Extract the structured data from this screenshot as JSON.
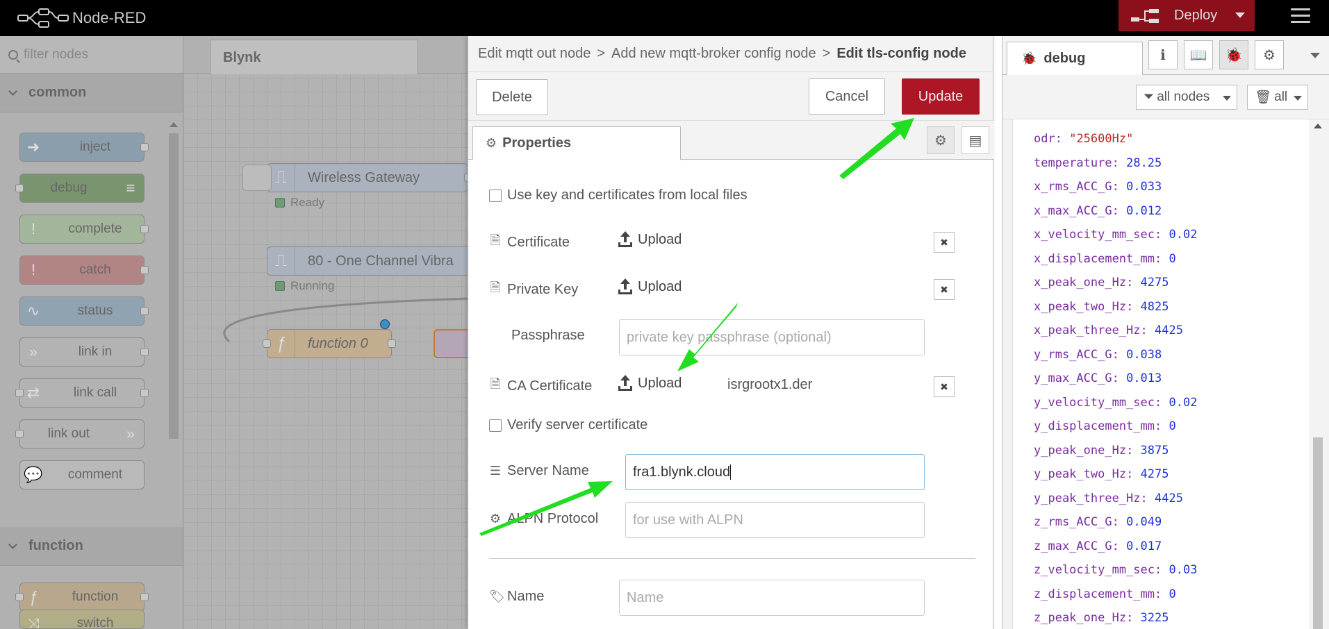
{
  "app": {
    "title": "Node-RED"
  },
  "header": {
    "deploy_label": "Deploy"
  },
  "palette": {
    "filter_placeholder": "filter nodes",
    "categories": [
      "common",
      "function"
    ],
    "nodes": [
      {
        "label": "inject",
        "color": "#8a9fab"
      },
      {
        "label": "debug",
        "color": "#7b9470"
      },
      {
        "label": "complete",
        "color": "#a3b59a"
      },
      {
        "label": "catch",
        "color": "#b28585"
      },
      {
        "label": "status",
        "color": "#8fa3b0"
      },
      {
        "label": "link in",
        "color": "#b3b3b3"
      },
      {
        "label": "link call",
        "color": "#b3b3b3"
      },
      {
        "label": "link out",
        "color": "#b3b3b3"
      },
      {
        "label": "comment",
        "color": "#b9b9b9"
      },
      {
        "label": "function",
        "color": "#b8a78c"
      },
      {
        "label": "switch",
        "color": "#b1ad86"
      }
    ]
  },
  "workspace": {
    "tab": "Blynk",
    "nodes": [
      {
        "label": "Wireless Gateway",
        "status": "Ready"
      },
      {
        "label": "80 - One Channel Vibra",
        "status": "Running"
      },
      {
        "label": "function 0",
        "status": ""
      }
    ]
  },
  "tray": {
    "breadcrumb": [
      "Edit mqtt out node",
      "Add new mqtt-broker config node",
      "Edit tls-config node"
    ],
    "breadcrumb_sep": ">",
    "buttons": {
      "delete": "Delete",
      "cancel": "Cancel",
      "update": "Update"
    },
    "tab_properties": "Properties",
    "form": {
      "use_local_files": "Use key and certificates from local files",
      "certificate": "Certificate",
      "private_key": "Private Key",
      "passphrase": "Passphrase",
      "passphrase_placeholder": "private key passphrase (optional)",
      "ca_certificate": "CA Certificate",
      "ca_file": "isrgrootx1.der",
      "upload": "Upload",
      "verify_server": "Verify server certificate",
      "server_name": "Server Name",
      "server_name_value": "fra1.blynk.cloud",
      "alpn_protocol": "ALPN Protocol",
      "alpn_placeholder": "for use with ALPN",
      "name": "Name",
      "name_placeholder": "Name"
    }
  },
  "sidebar": {
    "tab": "debug",
    "filter_nodes": "all nodes",
    "clear_all": "all",
    "messages": [
      {
        "key": "odr",
        "value": "\"25600Hz\"",
        "kind": "str"
      },
      {
        "key": "temperature",
        "value": "28.25",
        "kind": "num"
      },
      {
        "key": "x_rms_ACC_G",
        "value": "0.033",
        "kind": "num"
      },
      {
        "key": "x_max_ACC_G",
        "value": "0.012",
        "kind": "num"
      },
      {
        "key": "x_velocity_mm_sec",
        "value": "0.02",
        "kind": "num"
      },
      {
        "key": "x_displacement_mm",
        "value": "0",
        "kind": "num"
      },
      {
        "key": "x_peak_one_Hz",
        "value": "4275",
        "kind": "num"
      },
      {
        "key": "x_peak_two_Hz",
        "value": "4825",
        "kind": "num"
      },
      {
        "key": "x_peak_three_Hz",
        "value": "4425",
        "kind": "num"
      },
      {
        "key": "y_rms_ACC_G",
        "value": "0.038",
        "kind": "num"
      },
      {
        "key": "y_max_ACC_G",
        "value": "0.013",
        "kind": "num"
      },
      {
        "key": "y_velocity_mm_sec",
        "value": "0.02",
        "kind": "num"
      },
      {
        "key": "y_displacement_mm",
        "value": "0",
        "kind": "num"
      },
      {
        "key": "y_peak_one_Hz",
        "value": "3875",
        "kind": "num"
      },
      {
        "key": "y_peak_two_Hz",
        "value": "4275",
        "kind": "num"
      },
      {
        "key": "y_peak_three_Hz",
        "value": "4425",
        "kind": "num"
      },
      {
        "key": "z_rms_ACC_G",
        "value": "0.049",
        "kind": "num"
      },
      {
        "key": "z_max_ACC_G",
        "value": "0.017",
        "kind": "num"
      },
      {
        "key": "z_velocity_mm_sec",
        "value": "0.03",
        "kind": "num"
      },
      {
        "key": "z_displacement_mm",
        "value": "0",
        "kind": "num"
      },
      {
        "key": "z_peak_one_Hz",
        "value": "3225",
        "kind": "num"
      }
    ]
  },
  "colors": {
    "accent": "#ad1625",
    "header": "#000000",
    "annotation_arrow": "#22dd22"
  }
}
